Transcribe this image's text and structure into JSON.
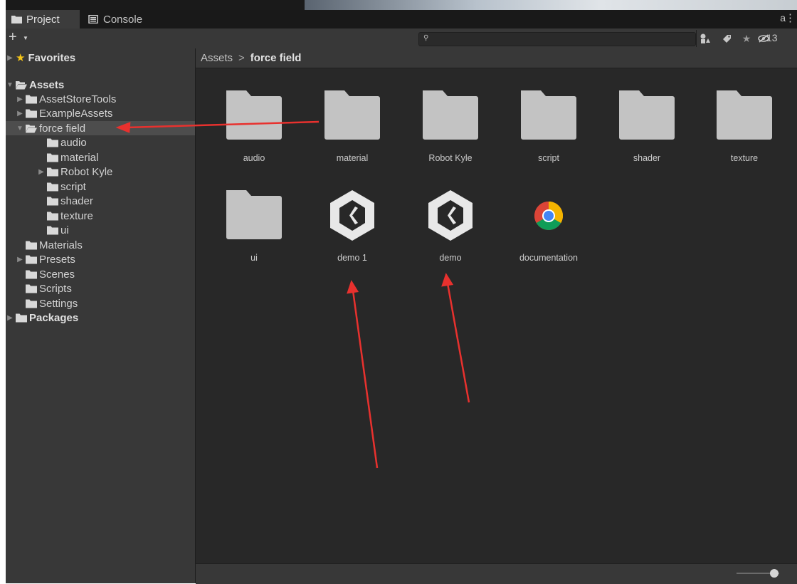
{
  "tabs": {
    "project": "Project",
    "console": "Console"
  },
  "toolbar": {
    "create": "+",
    "hidden_count": "13",
    "search_placeholder": ""
  },
  "tree": {
    "favorites": "Favorites",
    "assets": "Assets",
    "asset_store_tools": "AssetStoreTools",
    "example_assets": "ExampleAssets",
    "force_field": "force field",
    "audio": "audio",
    "material": "material",
    "robot_kyle": "Robot Kyle",
    "script": "script",
    "shader": "shader",
    "texture": "texture",
    "ui": "ui",
    "materials": "Materials",
    "presets": "Presets",
    "scenes": "Scenes",
    "scripts": "Scripts",
    "settings": "Settings",
    "packages": "Packages"
  },
  "breadcrumb": {
    "root": "Assets",
    "separator": ">",
    "current": "force field"
  },
  "grid": {
    "items": [
      {
        "label": "audio",
        "icon": "folder-icon"
      },
      {
        "label": "material",
        "icon": "folder-icon"
      },
      {
        "label": "Robot Kyle",
        "icon": "folder-icon"
      },
      {
        "label": "script",
        "icon": "folder-icon"
      },
      {
        "label": "shader",
        "icon": "folder-icon"
      },
      {
        "label": "texture",
        "icon": "folder-icon"
      },
      {
        "label": "ui",
        "icon": "folder-icon"
      },
      {
        "label": "demo 1",
        "icon": "unity-scene-icon"
      },
      {
        "label": "demo",
        "icon": "unity-scene-icon"
      },
      {
        "label": "documentation",
        "icon": "chrome-icon"
      }
    ]
  },
  "colors": {
    "panel": "#383838",
    "grid_bg": "#282828",
    "folder": "#c3c3c3",
    "selection": "#4d4d4d",
    "annotation_arrow": "#e8312e",
    "favorites_star": "#f5c518"
  }
}
